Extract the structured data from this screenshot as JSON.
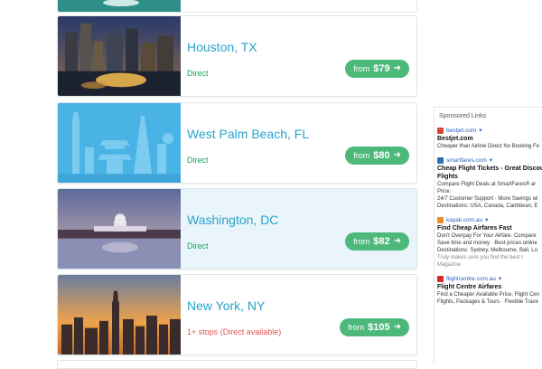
{
  "results": [
    {
      "city": "Houston, TX",
      "stops": "Direct",
      "price_prefix": "from",
      "price": "$79",
      "stops_color": "#1b9e5a"
    },
    {
      "city": "West Palm Beach, FL",
      "stops": "Direct",
      "price_prefix": "from",
      "price": "$80",
      "stops_color": "#1b9e5a"
    },
    {
      "city": "Washington, DC",
      "stops": "Direct",
      "price_prefix": "from",
      "price": "$82",
      "stops_color": "#1b9e5a"
    },
    {
      "city": "New York, NY",
      "stops": "1+ stops (Direct available)",
      "price_prefix": "from",
      "price": "$105",
      "stops_color": "#e0564d"
    }
  ],
  "colors": {
    "city_link": "#2aa3c9",
    "price_button": "#4cb97b",
    "highlight_row": "#e9f5fb"
  },
  "sidebar": {
    "title": "Sponsored Links",
    "ads": [
      {
        "source": "bestjet.com",
        "headline": "Bestjet.com",
        "lines": [
          "Cheaper than Airline Direct No Booking Fe"
        ],
        "favicon_color": "#d9443a"
      },
      {
        "source": "smartfares.com",
        "headline": "Cheap Flight Tickets - Great Discou",
        "headline2": "Flights",
        "lines": [
          "Compare Flight Deals at SmartFares® ar",
          "Price.",
          "24/7 Customer Support · More Savings wi",
          "Destinations: USA, Canada, Caribbean, E"
        ],
        "favicon_color": "#2f6fb5"
      },
      {
        "source": "kayak.com.au",
        "headline": "Find Cheap Airfares Fast",
        "lines": [
          "Don't Overpay For Your Airfare. Compare",
          "Save time and money · Best prices online",
          "Destinations: Sydney, Melbourne, Bali, Lo",
          "Truly makes sure you find the best r",
          "Magazine"
        ],
        "favicon_color": "#f08a24"
      },
      {
        "source": "flightcentre.com.au",
        "headline": "Flight Centre Airfares",
        "lines": [
          "Find a Cheaper Available Price, Flight Cen",
          "Flights, Packages & Tours · Flexible Trave"
        ],
        "favicon_color": "#d42b2b"
      }
    ]
  }
}
